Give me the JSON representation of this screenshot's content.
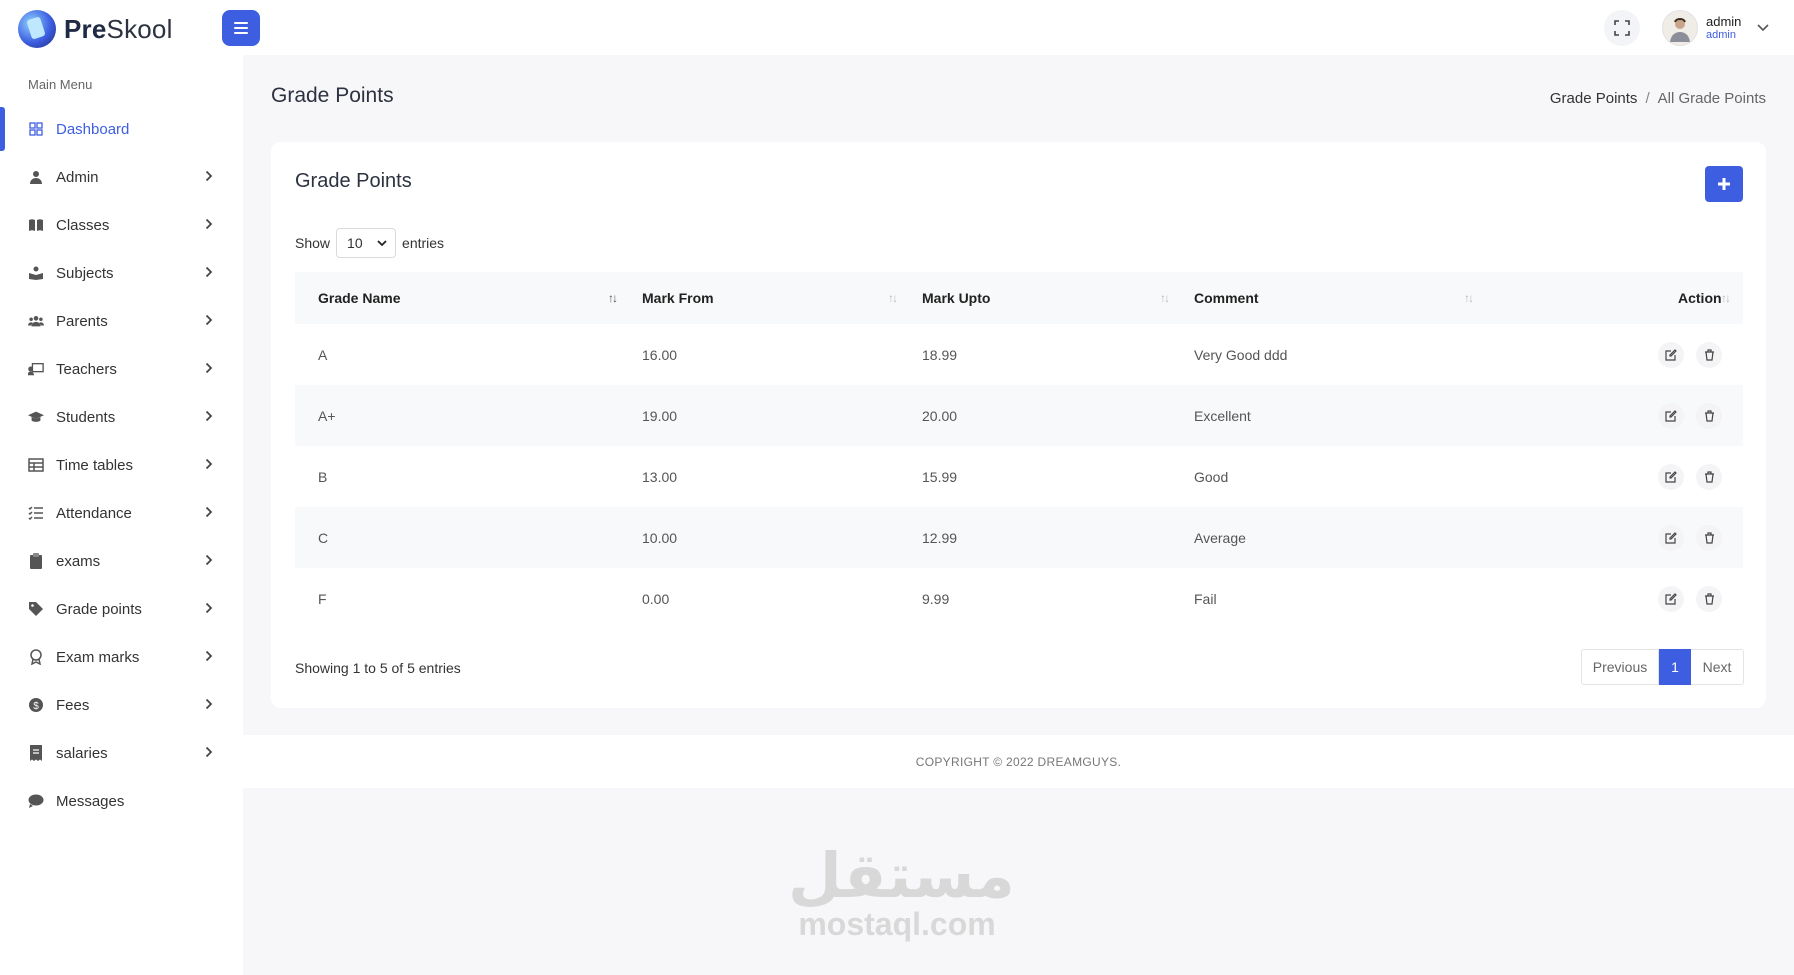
{
  "header": {
    "brand_prefix": "Pre",
    "brand_suffix": "Skool",
    "menu_toggle_icon": "hamburger-icon",
    "fullscreen_icon": "fullscreen-icon",
    "user": {
      "name": "admin",
      "role": "admin"
    }
  },
  "sidebar": {
    "title": "Main Menu",
    "items": [
      {
        "label": "Dashboard",
        "icon": "dashboard-grid-icon",
        "active": true,
        "has_arrow": false
      },
      {
        "label": "Admin",
        "icon": "user-tie-icon",
        "has_arrow": true
      },
      {
        "label": "Classes",
        "icon": "book-open-icon",
        "has_arrow": true
      },
      {
        "label": "Subjects",
        "icon": "book-reader-icon",
        "has_arrow": true
      },
      {
        "label": "Parents",
        "icon": "users-icon",
        "has_arrow": true
      },
      {
        "label": "Teachers",
        "icon": "chalkboard-teacher-icon",
        "has_arrow": true
      },
      {
        "label": "Students",
        "icon": "graduation-cap-icon",
        "has_arrow": true
      },
      {
        "label": "Time tables",
        "icon": "table-icon",
        "has_arrow": true
      },
      {
        "label": "Attendance",
        "icon": "list-check-icon",
        "has_arrow": true
      },
      {
        "label": "exams",
        "icon": "clipboard-icon",
        "has_arrow": true
      },
      {
        "label": "Grade points",
        "icon": "tag-icon",
        "has_arrow": true
      },
      {
        "label": "Exam marks",
        "icon": "award-icon",
        "has_arrow": true
      },
      {
        "label": "Fees",
        "icon": "dollar-circle-icon",
        "has_arrow": true
      },
      {
        "label": "salaries",
        "icon": "receipt-icon",
        "has_arrow": true
      },
      {
        "label": "Messages",
        "icon": "comment-icon",
        "has_arrow": false
      }
    ]
  },
  "page": {
    "title": "Grade Points",
    "breadcrumb": {
      "first": "Grade Points",
      "separator": "/",
      "current": "All Grade Points"
    }
  },
  "card": {
    "title": "Grade Points",
    "length": {
      "show": "Show",
      "value": "10",
      "entries": "entries"
    },
    "columns": [
      "Grade Name",
      "Mark From",
      "Mark Upto",
      "Comment",
      "Action"
    ],
    "rows": [
      {
        "grade": "A",
        "from": "16.00",
        "upto": "18.99",
        "comment": "Very Good ddd"
      },
      {
        "grade": "A+",
        "from": "19.00",
        "upto": "20.00",
        "comment": "Excellent"
      },
      {
        "grade": "B",
        "from": "13.00",
        "upto": "15.99",
        "comment": "Good"
      },
      {
        "grade": "C",
        "from": "10.00",
        "upto": "12.99",
        "comment": "Average"
      },
      {
        "grade": "F",
        "from": "0.00",
        "upto": "9.99",
        "comment": "Fail"
      }
    ],
    "info": "Showing 1 to 5 of 5 entries",
    "pagination": {
      "prev": "Previous",
      "page": "1",
      "next": "Next"
    }
  },
  "footer": {
    "text": "COPYRIGHT © 2022 DREAMGUYS."
  },
  "watermark": {
    "arabic": "مستقل",
    "latin": "mostaql.com"
  },
  "colors": {
    "primary": "#3d5ee1",
    "background": "#f7f7fa",
    "surface": "#ffffff"
  }
}
